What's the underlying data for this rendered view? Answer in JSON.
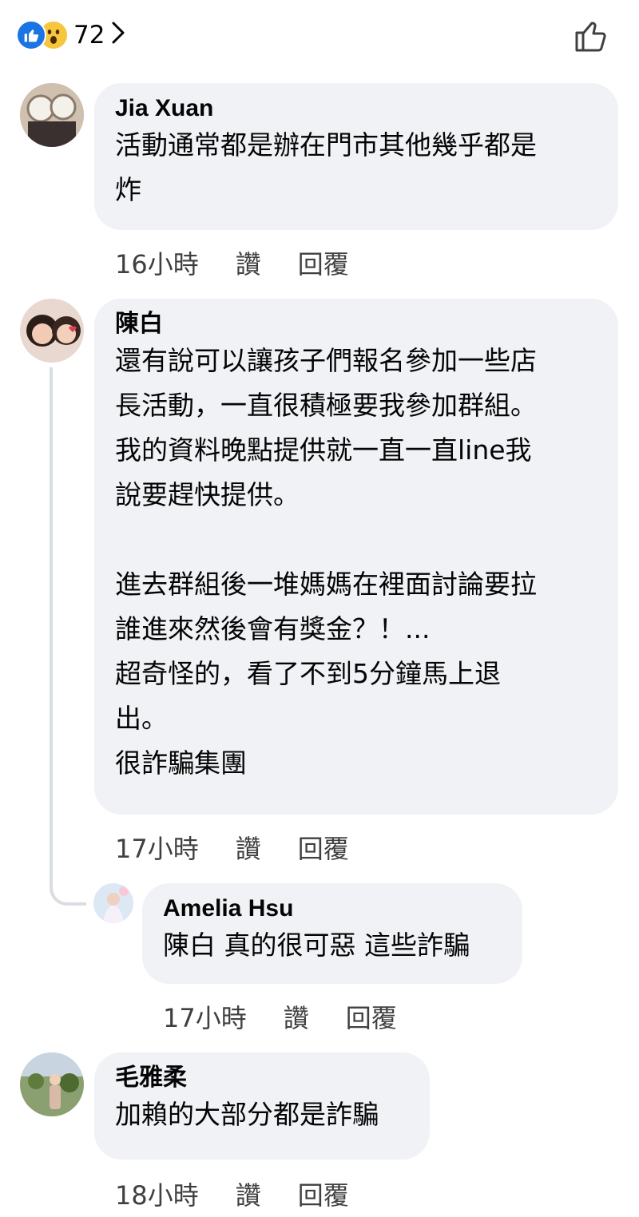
{
  "reactions": {
    "count": "72",
    "types": [
      "like-icon",
      "wow-icon"
    ]
  },
  "comments": [
    {
      "author": "Jia Xuan",
      "text": "活動通常都是辦在門市其他幾乎都是\n炸",
      "time": "16小時",
      "like_label": "讚",
      "reply_label": "回覆"
    },
    {
      "author": "陳白",
      "text": "還有說可以讓孩子們報名參加一些店\n長活動，一直很積極要我參加群組。\n我的資料晚點提供就一直一直line我\n說要趕快提供。\n\n進去群組後一堆媽媽在裡面討論要拉\n誰進來然後會有獎金？！...\n超奇怪的，看了不到5分鐘馬上退\n出。\n很詐騙集團",
      "time": "17小時",
      "like_label": "讚",
      "reply_label": "回覆"
    },
    {
      "author": "Amelia Hsu",
      "text": "陳白 真的很可惡 這些詐騙",
      "time": "17小時",
      "like_label": "讚",
      "reply_label": "回覆"
    },
    {
      "author": "毛雅柔",
      "text": "加賴的大部分都是詐騙",
      "time": "18小時",
      "like_label": "讚",
      "reply_label": "回覆"
    }
  ],
  "colors": {
    "bubble": "#f0f2f5",
    "like_blue": "#1b74e4",
    "wow_yellow": "#f7c63c",
    "meta_text": "#404040"
  }
}
